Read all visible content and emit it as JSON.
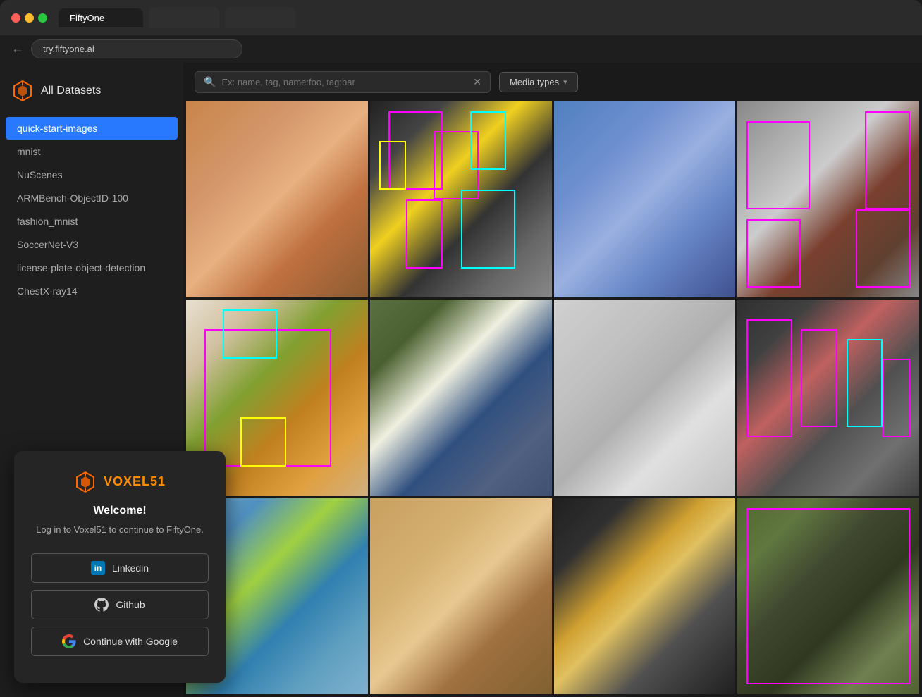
{
  "browser": {
    "tab_active": "FiftyOne",
    "tab_empty_1": "",
    "tab_empty_2": "",
    "address": "try.fiftyone.ai"
  },
  "sidebar": {
    "title": "All Datasets",
    "datasets": [
      {
        "id": "quick-start-images",
        "label": "quick-start-images",
        "active": true
      },
      {
        "id": "mnist",
        "label": "mnist",
        "active": false
      },
      {
        "id": "nuscenes",
        "label": "NuScenes",
        "active": false
      },
      {
        "id": "armbench",
        "label": "ARMBench-ObjectID-100",
        "active": false
      },
      {
        "id": "fashion-mnist",
        "label": "fashion_mnist",
        "active": false
      },
      {
        "id": "soccernet",
        "label": "SoccerNet-V3",
        "active": false
      },
      {
        "id": "license-plate",
        "label": "license-plate-object-detection",
        "active": false
      },
      {
        "id": "chestxray",
        "label": "ChestX-ray14",
        "active": false
      }
    ]
  },
  "toolbar": {
    "search_placeholder": "Ex: name, tag, name:foo, tag:bar",
    "media_types_label": "Media types",
    "chevron": "▾"
  },
  "modal": {
    "logo_v": "VOXEL",
    "logo_51": "51",
    "welcome": "Welcome!",
    "subtitle": "Log in to Voxel51 to continue to FiftyOne.",
    "btn_linkedin": "Linkedin",
    "btn_github": "Github",
    "btn_google": "Continue with Google"
  },
  "images": [
    {
      "id": "cat",
      "class": "img-cat",
      "has_bbox": false
    },
    {
      "id": "crowd",
      "class": "img-crowd",
      "has_bbox": true
    },
    {
      "id": "plane",
      "class": "img-plane",
      "has_bbox": false
    },
    {
      "id": "room",
      "class": "img-room",
      "has_bbox": true
    },
    {
      "id": "food",
      "class": "img-food",
      "has_bbox": true
    },
    {
      "id": "baseball",
      "class": "img-baseball",
      "has_bbox": false
    },
    {
      "id": "bench",
      "class": "img-bench",
      "has_bbox": false
    },
    {
      "id": "street",
      "class": "img-street",
      "has_bbox": true
    },
    {
      "id": "kite",
      "class": "img-kite",
      "has_bbox": false
    },
    {
      "id": "alpaca",
      "class": "img-alpaca",
      "has_bbox": false
    },
    {
      "id": "license",
      "class": "img-license",
      "has_bbox": false
    },
    {
      "id": "horse",
      "class": "img-horse",
      "has_bbox": true
    }
  ]
}
